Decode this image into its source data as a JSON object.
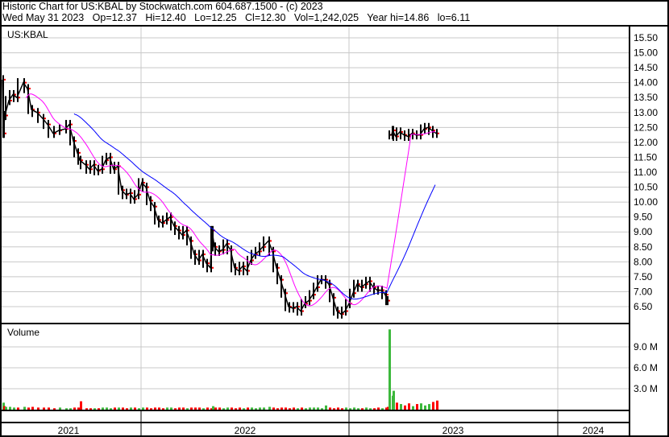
{
  "header": {
    "title": "Historic Chart for US:KBAL by Stockwatch.com 604.687.1500 - (c) 2023",
    "stats": "Wed May 31 2023   Op=12.37   Hi=12.40   Lo=12.25   Cl=12.30   Vol=1,242,025   Year hi=14.86   lo=6.11"
  },
  "colors": {
    "price": "#000000",
    "ma_short": "#ff00ff",
    "ma_long": "#0000ff",
    "vol_up": "#3cb83c",
    "vol_down": "#ff0000",
    "grid": "#c8c8c8"
  },
  "chart_data": {
    "type": "line",
    "symbol": "US:KBAL",
    "price_ticks": [
      "15.50",
      "15.00",
      "14.50",
      "14.00",
      "13.50",
      "13.00",
      "12.50",
      "12.00",
      "11.50",
      "11.00",
      "10.50",
      "10.00",
      "9.50",
      "9.00",
      "8.50",
      "8.00",
      "7.50",
      "7.00",
      "6.50"
    ],
    "ylim": [
      6.5,
      15.5
    ],
    "volume_label": "Volume",
    "volume_ticks": [
      "9.0 M",
      "6.0 M",
      "3.0 M"
    ],
    "x_labels": [
      "2021",
      "2022",
      "2023",
      "2024"
    ],
    "segments": [
      [
        [
          0,
          14.1,
          1.0
        ],
        [
          1,
          12.3,
          0.5
        ],
        [
          3,
          12.9,
          0.4
        ],
        [
          8,
          13.4,
          0.4
        ],
        [
          13,
          13.6,
          0.3
        ],
        [
          18,
          13.5,
          0.3
        ],
        [
          26,
          14.0,
          0.4
        ],
        [
          31,
          13.8,
          0.3
        ],
        [
          36,
          13.1,
          0.4
        ],
        [
          43,
          13.0,
          0.3
        ],
        [
          50,
          12.8,
          0.3
        ],
        [
          56,
          12.6,
          0.3
        ],
        [
          63,
          12.3,
          0.2
        ],
        [
          70,
          12.4,
          0.3
        ],
        [
          78,
          12.45,
          0.2
        ],
        [
          83,
          12.6,
          0.2
        ],
        [
          88,
          12.05,
          0.3
        ],
        [
          93,
          11.65,
          0.3
        ],
        [
          96,
          11.4,
          1.2
        ],
        [
          103,
          11.25,
          0.2
        ],
        [
          108,
          11.1,
          0.2
        ],
        [
          113,
          11.25,
          0.2
        ],
        [
          118,
          11.05,
          0.2
        ],
        [
          123,
          11.1,
          0.3
        ],
        [
          128,
          11.4,
          0.3
        ],
        [
          133,
          11.5,
          0.2
        ],
        [
          138,
          11.1,
          0.3
        ],
        [
          143,
          11.2,
          0.3
        ],
        [
          148,
          10.4,
          0.3
        ],
        [
          153,
          10.25,
          0.2
        ],
        [
          158,
          10.3,
          0.3
        ],
        [
          163,
          10.1,
          0.3
        ],
        [
          168,
          10.25,
          0.2
        ],
        [
          173,
          10.65,
          0.3
        ],
        [
          178,
          10.5,
          0.3
        ],
        [
          183,
          10.05,
          0.2
        ],
        [
          188,
          9.85,
          0.3
        ],
        [
          193,
          9.4,
          0.3
        ],
        [
          198,
          9.3,
          0.2
        ],
        [
          203,
          9.4,
          0.3
        ],
        [
          208,
          9.5,
          0.3
        ],
        [
          213,
          9.2,
          0.2
        ],
        [
          218,
          9.05,
          0.3
        ],
        [
          223,
          8.9,
          0.3
        ],
        [
          228,
          9.05,
          0.2
        ],
        [
          233,
          8.7,
          0.3
        ],
        [
          238,
          8.25,
          0.3
        ],
        [
          243,
          8.05,
          0.3
        ],
        [
          248,
          8.25,
          0.2
        ],
        [
          253,
          7.95,
          0.3
        ],
        [
          258,
          7.8,
          0.2
        ],
        [
          260,
          9.05,
          0.5
        ],
        [
          263,
          8.5,
          0.3
        ],
        [
          268,
          8.35,
          0.3
        ],
        [
          273,
          8.4,
          0.2
        ],
        [
          278,
          8.6,
          0.3
        ],
        [
          283,
          8.4,
          0.3
        ],
        [
          288,
          7.8,
          0.2
        ],
        [
          293,
          7.7,
          0.3
        ],
        [
          298,
          7.85,
          0.2
        ],
        [
          303,
          7.7,
          0.3
        ],
        [
          308,
          8.05,
          0.3
        ],
        [
          313,
          8.25,
          0.2
        ],
        [
          318,
          8.35,
          0.3
        ],
        [
          323,
          8.5,
          0.3
        ],
        [
          330,
          8.7,
          0.4
        ],
        [
          335,
          8.35,
          0.3
        ],
        [
          340,
          7.8,
          0.2
        ],
        [
          345,
          7.4,
          0.3
        ],
        [
          350,
          6.95,
          0.3
        ],
        [
          355,
          6.5,
          0.2
        ],
        [
          360,
          6.45,
          0.3
        ],
        [
          365,
          6.5,
          0.2
        ],
        [
          370,
          6.35,
          0.3
        ],
        [
          375,
          6.6,
          0.2
        ],
        [
          380,
          6.7,
          0.3
        ],
        [
          385,
          6.9,
          0.3
        ],
        [
          390,
          7.15,
          0.3
        ],
        [
          395,
          7.4,
          0.2
        ],
        [
          400,
          7.4,
          0.6
        ],
        [
          405,
          7.25,
          0.3
        ],
        [
          410,
          6.8,
          0.2
        ],
        [
          415,
          6.35,
          0.3
        ],
        [
          420,
          6.25,
          0.2
        ],
        [
          425,
          6.35,
          0.3
        ],
        [
          430,
          6.6,
          0.2
        ],
        [
          435,
          6.95,
          0.3
        ],
        [
          440,
          7.25,
          0.2
        ],
        [
          445,
          7.15,
          0.2
        ],
        [
          450,
          7.25,
          0.3
        ],
        [
          455,
          7.35,
          0.2
        ],
        [
          460,
          7.15,
          0.2
        ],
        [
          465,
          7.05,
          0.3
        ],
        [
          470,
          7.05,
          0.2
        ],
        [
          475,
          6.9,
          0.3
        ],
        [
          477,
          6.7,
          0.4
        ]
      ],
      [
        [
          479,
          12.25,
          11.5
        ],
        [
          483,
          12.25,
          2.0
        ],
        [
          484,
          12.4,
          2.7
        ],
        [
          488,
          12.2,
          1.0
        ],
        [
          493,
          12.35,
          0.8
        ],
        [
          498,
          12.25,
          0.6
        ],
        [
          503,
          12.2,
          0.9
        ],
        [
          508,
          12.3,
          0.5
        ],
        [
          513,
          12.25,
          0.8
        ],
        [
          518,
          12.25,
          0.9
        ],
        [
          523,
          12.45,
          0.6
        ],
        [
          528,
          12.5,
          0.8
        ],
        [
          533,
          12.4,
          1.1
        ],
        [
          538,
          12.3,
          1.3
        ]
      ]
    ]
  }
}
